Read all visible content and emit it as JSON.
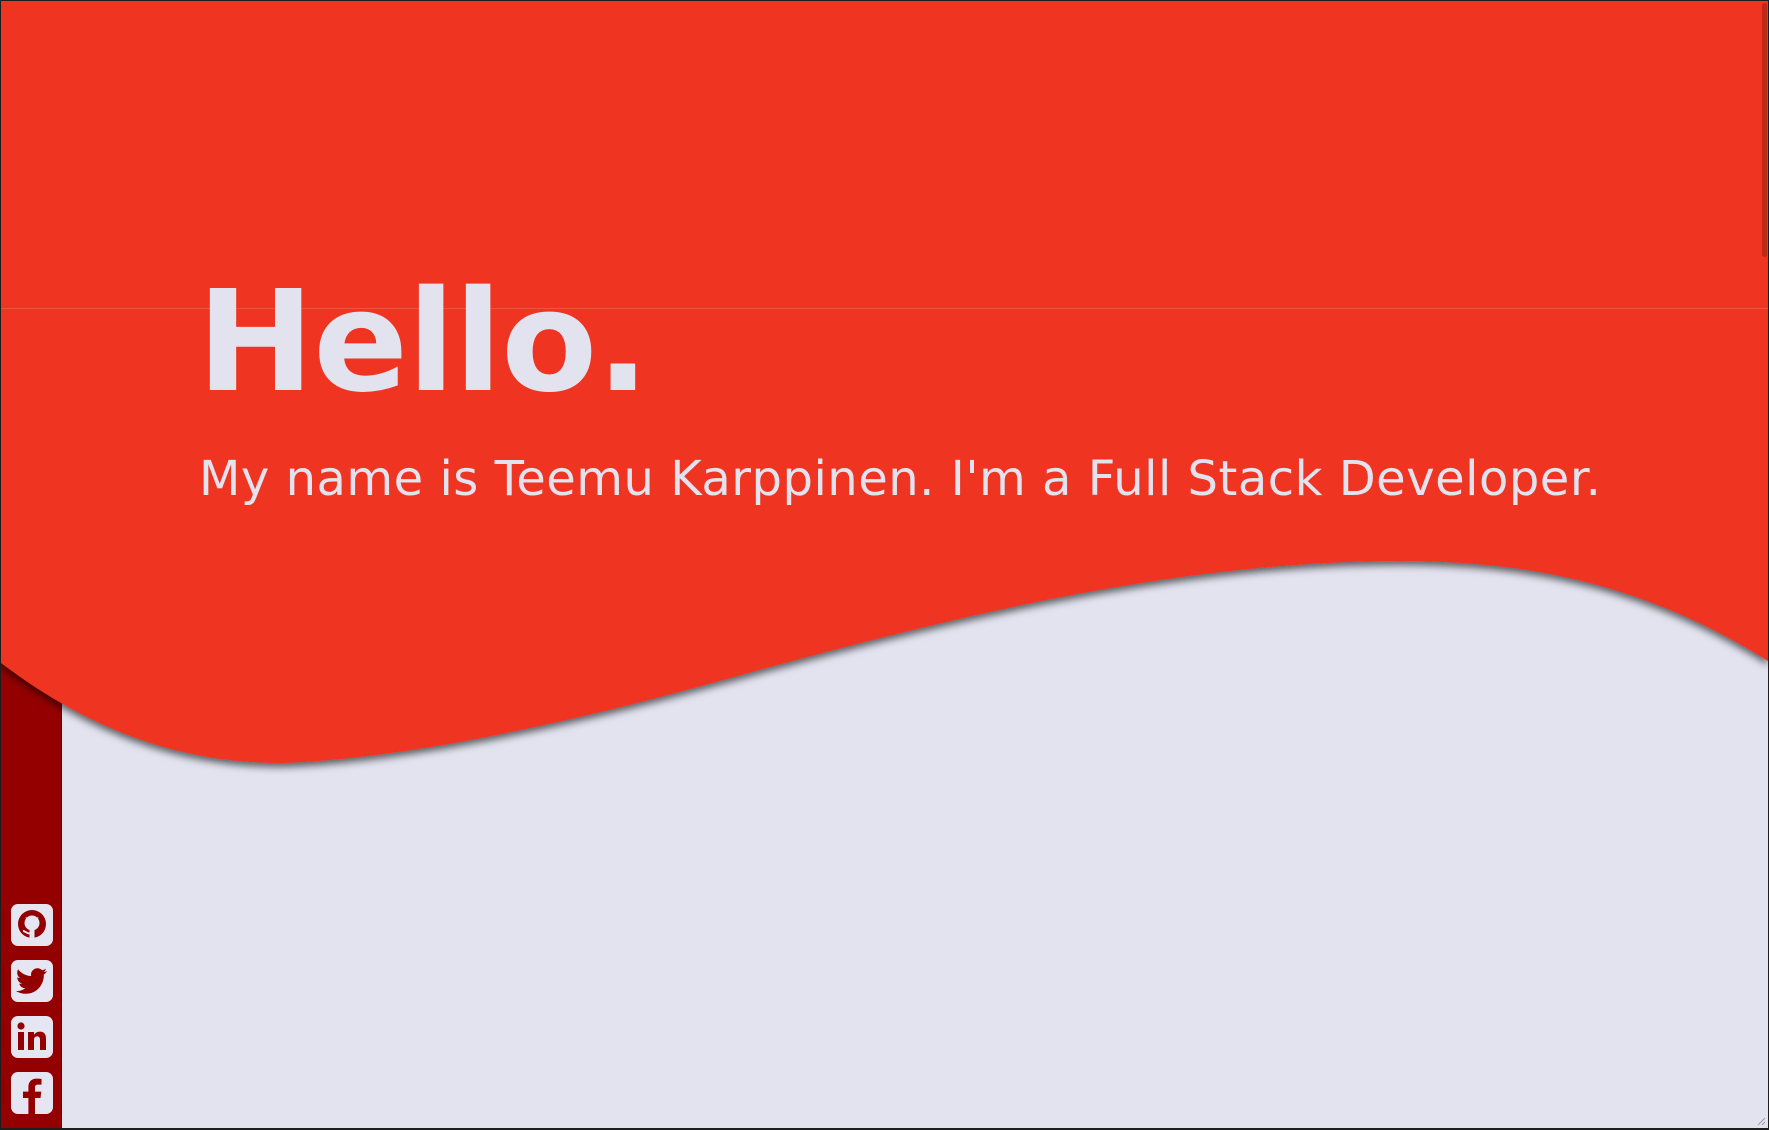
{
  "colors": {
    "hero_red": "#ef3520",
    "sidebar_red": "#940000",
    "page_background": "#e2e3ef",
    "text_light": "#e3e3ef"
  },
  "hero": {
    "title": "Hello.",
    "subtitle": "My name is Teemu Karppinen. I'm a Full Stack Developer."
  },
  "social": [
    {
      "id": "github",
      "icon": "github-icon"
    },
    {
      "id": "twitter",
      "icon": "twitter-icon"
    },
    {
      "id": "linkedin",
      "icon": "linkedin-icon"
    },
    {
      "id": "facebook",
      "icon": "facebook-icon"
    }
  ]
}
